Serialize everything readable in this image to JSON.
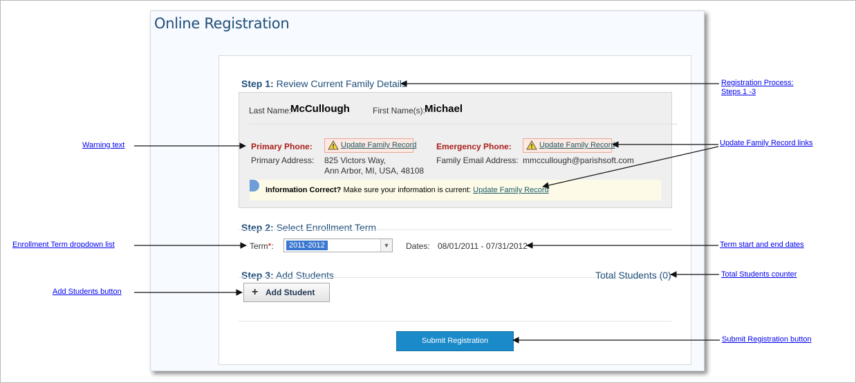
{
  "page": {
    "title": "Online Registration"
  },
  "step1": {
    "num": "Step 1:",
    "title": "Review Current Family Details",
    "last_name_label": "Last Name:",
    "last_name": "McCullough",
    "first_name_label": "First Name(s):",
    "first_name": "Michael",
    "primary_phone_label": "Primary Phone:",
    "primary_phone_link": "Update Family Record",
    "emergency_phone_label": "Emergency Phone:",
    "emergency_phone_link": "Update Family Record",
    "primary_address_label": "Primary Address:",
    "primary_address_line1": "825 Victors Way,",
    "primary_address_line2": "Ann Arbor, MI, USA, 48108",
    "email_label": "Family Email Address:",
    "email": "mmccullough@parishsoft.com",
    "info_bold": "Information Correct?",
    "info_text": "Make sure your information is current:",
    "info_link": "Update Family Record"
  },
  "step2": {
    "num": "Step 2:",
    "title": "Select Enrollment Term",
    "term_label": "Term",
    "required_mark": "*",
    "term_colon": ":",
    "term_value": "2011-2012",
    "dates_label": "Dates:",
    "dates_value": "08/01/2011 - 07/31/2012"
  },
  "step3": {
    "num": "Step 3:",
    "title": "Add Students",
    "total_students": "Total Students (0)",
    "add_student_label": "Add Student"
  },
  "submit_label": "Submit Registration",
  "callouts": {
    "registration_process_1": "Registration Process:",
    "registration_process_2": "Steps 1 -3",
    "warning_text": "Warning text",
    "update_family_record_links": "Update Family Record links",
    "enrollment_term_dropdown": "Enrollment Term dropdown list",
    "term_dates": "Term start and end dates",
    "total_students_counter": "Total Students counter",
    "add_students_button": "Add Students button",
    "submit_button": "Submit Registration button"
  },
  "colors": {
    "title_blue": "#1f4e79",
    "warning_red": "#a8201a",
    "submit_blue": "#1b8ac9",
    "link_blue": "#0000ee"
  },
  "icons": [
    "warning-icon",
    "info-icon",
    "plus-icon",
    "chevron-down-icon"
  ]
}
